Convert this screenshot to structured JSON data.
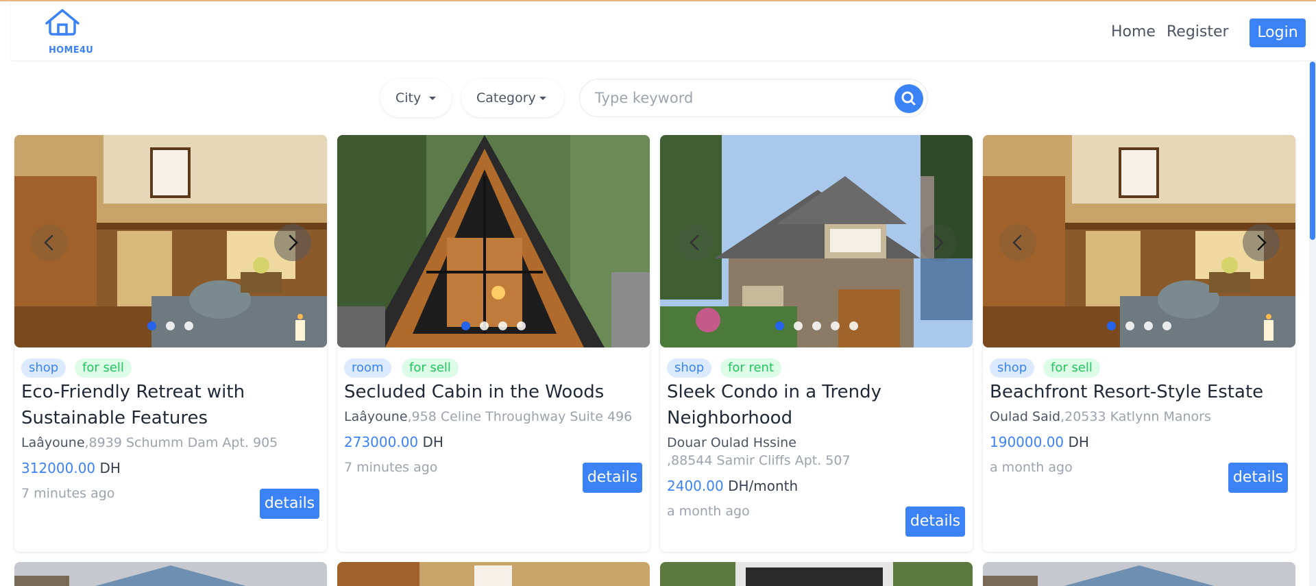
{
  "brand": {
    "name": "HOME4U",
    "color": "#3b82f6",
    "logo_icon": "house-icon"
  },
  "nav": {
    "home": "Home",
    "register": "Register",
    "login": "Login"
  },
  "filters": {
    "city": "City",
    "category": "Category",
    "search_placeholder": "Type keyword",
    "search_icon": "search-icon"
  },
  "listings": [
    {
      "type": "shop",
      "deal": "for sell",
      "title": "Eco-Friendly Retreat with Sustainable Features",
      "city": "Laâyoune",
      "address": ",8939 Schumm Dam Apt. 905",
      "price": "312000.00",
      "currency": "DH",
      "unit": "",
      "time": "7 minutes ago",
      "details": "details",
      "photo_count": 3,
      "active_photo": 0
    },
    {
      "type": "room",
      "deal": "for sell",
      "title": "Secluded Cabin in the Woods",
      "city": "Laâyoune",
      "address": ",958 Celine Throughway Suite 496",
      "price": "273000.00",
      "currency": "DH",
      "unit": "",
      "time": "7 minutes ago",
      "details": "details",
      "photo_count": 4,
      "active_photo": 0
    },
    {
      "type": "shop",
      "deal": "for rent",
      "title": "Sleek Condo in a Trendy Neighborhood",
      "city": "Douar Oulad Hssine",
      "address": ",88544 Samir Cliffs Apt. 507",
      "price": "2400.00",
      "currency": "DH",
      "unit": "/month",
      "time": "a month ago",
      "details": "details",
      "photo_count": 5,
      "active_photo": 0
    },
    {
      "type": "shop",
      "deal": "for sell",
      "title": "Beachfront Resort-Style Estate",
      "city": "Oulad Said",
      "address": ",20533 Katlynn Manors",
      "price": "190000.00",
      "currency": "DH",
      "unit": "",
      "time": "a month ago",
      "details": "details",
      "photo_count": 4,
      "active_photo": 0
    }
  ],
  "colors": {
    "accent": "#3b82f6",
    "tag_type_bg": "#dbeafe",
    "tag_deal_bg": "#dcfce7",
    "tag_deal_text": "#22c55e"
  }
}
